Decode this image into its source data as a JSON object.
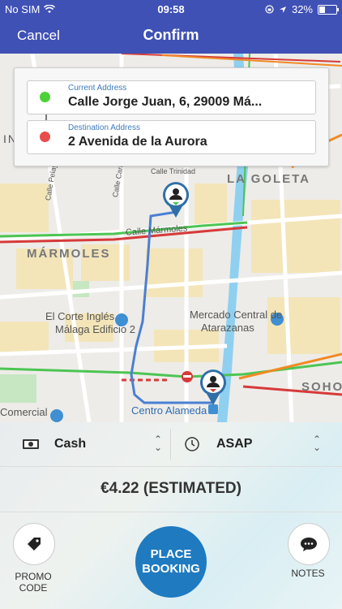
{
  "status_bar": {
    "carrier": "No SIM",
    "time": "09:58",
    "battery_percent": "32%",
    "battery_level": 0.32,
    "icons": [
      "wifi-icon",
      "lock-rotation-icon",
      "location-arrow-icon",
      "battery-icon"
    ]
  },
  "nav": {
    "cancel": "Cancel",
    "title": "Confirm"
  },
  "addresses": {
    "current": {
      "label": "Current Address",
      "value": "Calle Jorge Juan, 6, 29009 Má...",
      "dot_color": "#4cd137"
    },
    "destination": {
      "label": "Destination Address",
      "value": "2 Avenida de la Aurora",
      "dot_color": "#e84c4c"
    }
  },
  "map_labels": {
    "la_goleta": "LA GOLETA",
    "marmoles": "MÁRMOLES",
    "calle_marmoles": "Calle Mármoles",
    "calle_trinidad": "Calle Trinidad",
    "calle_pelayo": "Calle Pelayo",
    "calle_carril": "Calle Carril",
    "corte_ingles_1": "El Corte Inglés",
    "corte_ingles_2": "Málaga Edificio 2",
    "mercado_1": "Mercado Central de",
    "mercado_2": "Atarazanas",
    "soho": "SOHO",
    "comercial": "Comercial",
    "centro_alameda": "Centro Alameda",
    "in_fragment": "IN"
  },
  "payment": {
    "method": "Cash",
    "time": "ASAP"
  },
  "price": "€4.22 (ESTIMATED)",
  "actions": {
    "promo": "PROMO\nCODE",
    "place_line1": "PLACE",
    "place_line2": "BOOKING",
    "notes": "NOTES"
  },
  "colors": {
    "brand": "#3f51b5",
    "accent_button": "#1f7ac0",
    "route": "#4a7fd4"
  }
}
